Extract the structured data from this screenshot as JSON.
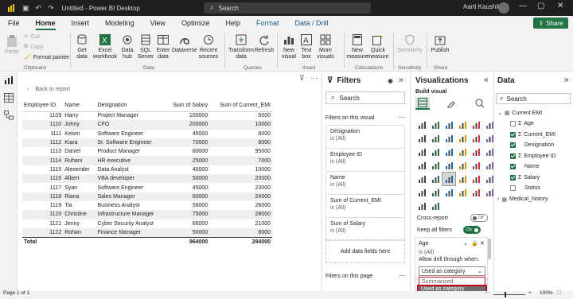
{
  "titlebar": {
    "doc_title": "Untitled - Power BI Desktop",
    "search_placeholder": "Search",
    "user": "Aarti Kaushik"
  },
  "tabs": [
    "File",
    "Home",
    "Insert",
    "Modeling",
    "View",
    "Optimize",
    "Help",
    "Format",
    "Data / Drill"
  ],
  "share_label": "Share",
  "ribbon": {
    "clipboard": {
      "paste": "Paste",
      "cut": "Cut",
      "copy": "Copy",
      "format_painter": "Format painter",
      "group": "Clipboard"
    },
    "data": {
      "get_data": "Get",
      "get_data2": "data",
      "excel": "Excel",
      "excel2": "workbook",
      "hub": "Data",
      "hub2": "hub",
      "sql": "SQL",
      "sql2": "Server",
      "enter": "Enter",
      "enter2": "data",
      "dataverse": "Dataverse",
      "recent": "Recent",
      "recent2": "sources",
      "group": "Data"
    },
    "queries": {
      "transform": "Transform",
      "transform2": "data",
      "refresh": "Refresh",
      "group": "Queries"
    },
    "insert": {
      "new_visual": "New",
      "new_visual2": "visual",
      "text_box": "Text",
      "text_box2": "box",
      "more": "More",
      "more2": "visuals",
      "group": "Insert"
    },
    "calc": {
      "quick": "Quick",
      "measure": "New",
      "measure2": "measure",
      "quick2": "measure",
      "group": "Calculations"
    },
    "sens": {
      "label": "Sensitivity",
      "group": "Sensitivity"
    },
    "share": {
      "publish": "Publish",
      "group": "Share"
    }
  },
  "canvas": {
    "back_label": "Back to report",
    "columns": [
      "Employee ID",
      "Name",
      "Designation",
      "Sum of Salary",
      "Sum of Current_EMI"
    ],
    "rows": [
      [
        "1109",
        "Harry",
        "Project Manager",
        "100000",
        "5000"
      ],
      [
        "1110",
        "Johny",
        "CFO",
        "200000",
        "10000"
      ],
      [
        "1111",
        "Kelvin",
        "Software Engineer",
        "45000",
        "8000"
      ],
      [
        "1112",
        "Kiara",
        "Sr. Software Engineer",
        "70000",
        "9000"
      ],
      [
        "1113",
        "Daniel",
        "Product Manager",
        "80000",
        "95000"
      ],
      [
        "1114",
        "Ruhani",
        "HR executive",
        "25000",
        "7000"
      ],
      [
        "1115",
        "Alexender",
        "Data Analyst",
        "40000",
        "10000"
      ],
      [
        "1116",
        "Albert",
        "VBA developer",
        "50000",
        "20000"
      ],
      [
        "1117",
        "Syan",
        "Software Engineer",
        "45000",
        "23000"
      ],
      [
        "1118",
        "Riana",
        "Sales Manager",
        "60000",
        "24000"
      ],
      [
        "1119",
        "Tia",
        "Business Analyst",
        "58000",
        "26000"
      ],
      [
        "1120",
        "Christine",
        "Infrastructure Manager",
        "75000",
        "28000"
      ],
      [
        "1121",
        "Jenny",
        "Cyber Security Analyst",
        "66000",
        "21000"
      ],
      [
        "1122",
        "Rohan",
        "Finance Manager",
        "50000",
        "8000"
      ]
    ],
    "total": [
      "Total",
      "",
      "",
      "964000",
      "294000"
    ]
  },
  "filters": {
    "title": "Filters",
    "search": "Search",
    "section_visual": "Filters on this visual",
    "cards": [
      {
        "name": "Designation",
        "value": "is (All)"
      },
      {
        "name": "Employee ID",
        "value": "is (All)"
      },
      {
        "name": "Name",
        "value": "is (All)"
      },
      {
        "name": "Sum of Current_EMI",
        "value": "is (All)"
      },
      {
        "name": "Sum of Salary",
        "value": "is (All)"
      }
    ],
    "add_fields": "Add data fields here",
    "section_page": "Filters on this page"
  },
  "viz": {
    "title": "Visualizations",
    "build": "Build visual",
    "cross_report": "Cross-report",
    "cross_state": "Off",
    "keep_filters": "Keep all filters",
    "keep_state": "On",
    "field": "Age",
    "field_value": "is (All)",
    "allow_label": "Allow drill through when:",
    "dropdown_value": "Used as category",
    "options": [
      "Summarized",
      "Used as category"
    ]
  },
  "data": {
    "title": "Data",
    "search": "Search",
    "tables": [
      {
        "name": "Current EMI",
        "fields": [
          {
            "name": "Age",
            "checked": false,
            "sigma": true
          },
          {
            "name": "Current_EMI",
            "checked": true,
            "sigma": true
          },
          {
            "name": "Designation",
            "checked": true,
            "sigma": false
          },
          {
            "name": "Employee ID",
            "checked": true,
            "sigma": true
          },
          {
            "name": "Name",
            "checked": true,
            "sigma": false
          },
          {
            "name": "Salary",
            "checked": true,
            "sigma": true
          },
          {
            "name": "Status",
            "checked": false,
            "sigma": false
          }
        ]
      },
      {
        "name": "Medical_history",
        "fields": []
      }
    ]
  },
  "status": {
    "page": "Page 1 of 1",
    "zoom": "100%"
  },
  "colors": {
    "accent": "#217346",
    "titlebar": "#1f1f1f",
    "highlight": "#c50f1f"
  }
}
